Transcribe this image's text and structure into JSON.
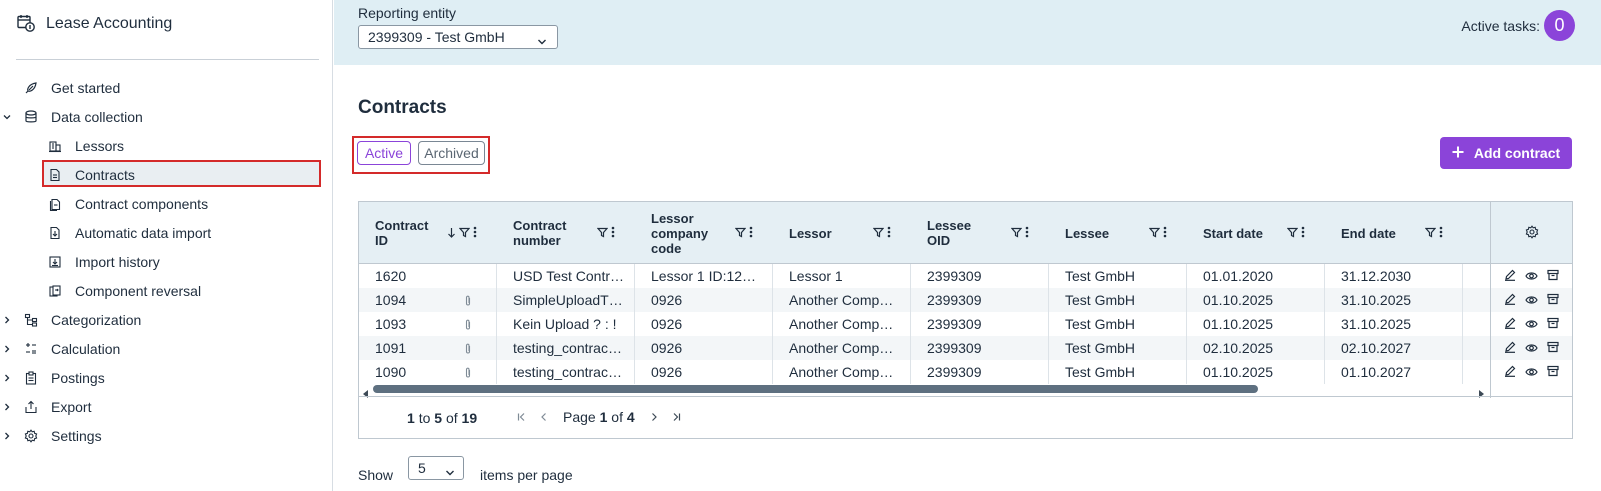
{
  "app": {
    "title": "Lease Accounting"
  },
  "sidebar": {
    "items": [
      {
        "label": "Get started",
        "icon": "rocket-icon"
      },
      {
        "label": "Data collection",
        "icon": "database-icon",
        "expanded": true
      },
      {
        "label": "Lessors",
        "icon": "building-icon"
      },
      {
        "label": "Contracts",
        "icon": "document-icon",
        "selected": true
      },
      {
        "label": "Contract components",
        "icon": "components-icon"
      },
      {
        "label": "Automatic data import",
        "icon": "import-file-icon"
      },
      {
        "label": "Import history",
        "icon": "download-history-icon"
      },
      {
        "label": "Component reversal",
        "icon": "reversal-icon"
      },
      {
        "label": "Categorization",
        "icon": "hierarchy-icon"
      },
      {
        "label": "Calculation",
        "icon": "calculator-icon"
      },
      {
        "label": "Postings",
        "icon": "clipboard-icon"
      },
      {
        "label": "Export",
        "icon": "export-icon"
      },
      {
        "label": "Settings",
        "icon": "gear-icon"
      }
    ]
  },
  "header": {
    "reporting_entity_label": "Reporting entity",
    "reporting_entity_value": "2399309 - Test GmbH",
    "active_tasks_label": "Active tasks:",
    "active_tasks_count": "0"
  },
  "main": {
    "title": "Contracts",
    "filters": {
      "active": "Active",
      "archived": "Archived"
    },
    "add_button": "Add contract"
  },
  "table": {
    "columns": [
      "Contract ID",
      "Contract number",
      "Lessor company code",
      "Lessor",
      "Lessee OID",
      "Lessee",
      "Start date",
      "End date"
    ],
    "rows": [
      {
        "id": "1620",
        "number": "USD Test Contr…",
        "code": "Lessor 1 ID:12…",
        "lessor": "Lessor 1",
        "oid": "2399309",
        "lessee": "Test GmbH",
        "start": "01.01.2020",
        "end": "31.12.2030",
        "attachment": false
      },
      {
        "id": "1094",
        "number": "SimpleUploadT…",
        "code": "0926",
        "lessor": "Another Comp…",
        "oid": "2399309",
        "lessee": "Test GmbH",
        "start": "01.10.2025",
        "end": "31.10.2025",
        "attachment": true
      },
      {
        "id": "1093",
        "number": "Kein Upload ? : !",
        "code": "0926",
        "lessor": "Another Comp…",
        "oid": "2399309",
        "lessee": "Test GmbH",
        "start": "01.10.2025",
        "end": "31.10.2025",
        "attachment": true
      },
      {
        "id": "1091",
        "number": "testing_contrac…",
        "code": "0926",
        "lessor": "Another Comp…",
        "oid": "2399309",
        "lessee": "Test GmbH",
        "start": "02.10.2025",
        "end": "02.10.2027",
        "attachment": true
      },
      {
        "id": "1090",
        "number": "testing_contrac…",
        "code": "0926",
        "lessor": "Another Comp…",
        "oid": "2399309",
        "lessee": "Test GmbH",
        "start": "01.10.2025",
        "end": "01.10.2027",
        "attachment": true
      }
    ]
  },
  "pagination": {
    "range_from": "1",
    "range_to_word": "to",
    "range_to": "5",
    "of_word": "of",
    "total": "19",
    "page_word": "Page",
    "current_page": "1",
    "total_pages": "4"
  },
  "page_size": {
    "show_label": "Show",
    "value": "5",
    "suffix": "items per page"
  },
  "colors": {
    "accent": "#8b44d9",
    "header_bg": "#dfeef4",
    "highlight": "#d42a2a"
  }
}
